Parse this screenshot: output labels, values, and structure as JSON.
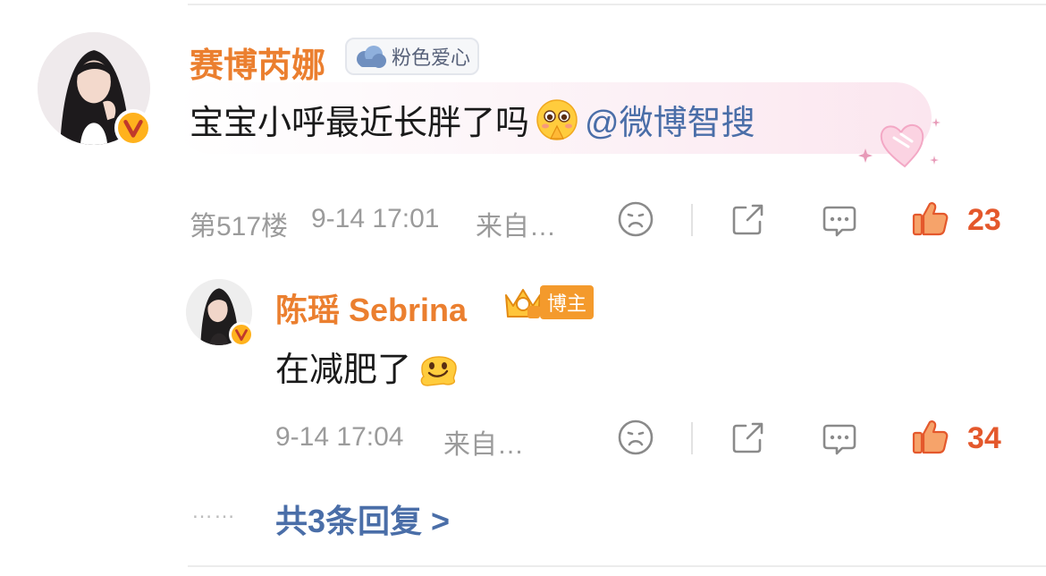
{
  "comment": {
    "author": "赛博芮娜",
    "fan_badge": "粉色爱心",
    "text": "宝宝小呼最近长胖了吗",
    "mention": "@微博智搜",
    "floor": "第517楼",
    "time": "9-14 17:01",
    "source": "来自…",
    "likes": "23"
  },
  "reply": {
    "author": "陈瑶 Sebrina",
    "badge_text": "博主",
    "text": "在减肥了",
    "time": "9-14 17:04",
    "source": "来自…",
    "likes": "34"
  },
  "more_replies": {
    "dots": "……",
    "label": "共3条回复 >"
  },
  "colors": {
    "name": "#eb7f2f",
    "link": "#4a6ea8",
    "like": "#e4582c",
    "meta": "#9b9b9b"
  }
}
